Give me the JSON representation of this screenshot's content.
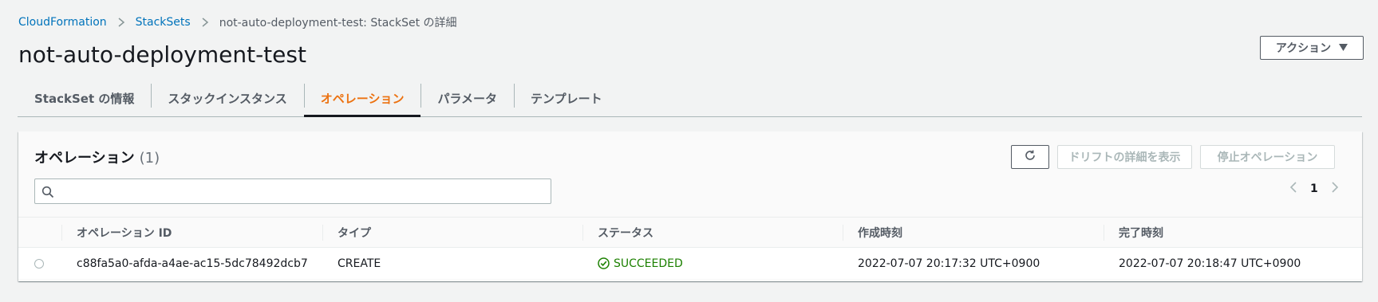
{
  "breadcrumb": {
    "items": [
      "CloudFormation",
      "StackSets"
    ],
    "current": "not-auto-deployment-test: StackSet の詳細"
  },
  "page": {
    "title": "not-auto-deployment-test",
    "action_label": "アクション"
  },
  "tabs": [
    {
      "label": "StackSet の情報",
      "active": false
    },
    {
      "label": "スタックインスタンス",
      "active": false
    },
    {
      "label": "オペレーション",
      "active": true
    },
    {
      "label": "パラメータ",
      "active": false
    },
    {
      "label": "テンプレート",
      "active": false
    }
  ],
  "panel": {
    "title": "オペレーション",
    "count": "(1)",
    "drift_button": "ドリフトの詳細を表示",
    "stop_button": "停止オペレーション",
    "search_placeholder": "",
    "page_number": "1"
  },
  "table": {
    "columns": [
      "オペレーション ID",
      "タイプ",
      "ステータス",
      "作成時刻",
      "完了時刻"
    ],
    "rows": [
      {
        "id": "c88fa5a0-afda-a4ae-ac15-5dc78492dcb7",
        "type": "CREATE",
        "status": "SUCCEEDED",
        "created": "2022-07-07 20:17:32 UTC+0900",
        "completed": "2022-07-07 20:18:47 UTC+0900"
      }
    ]
  },
  "colors": {
    "link": "#0073bb",
    "active_tab": "#ec7211",
    "success": "#1d8102"
  }
}
